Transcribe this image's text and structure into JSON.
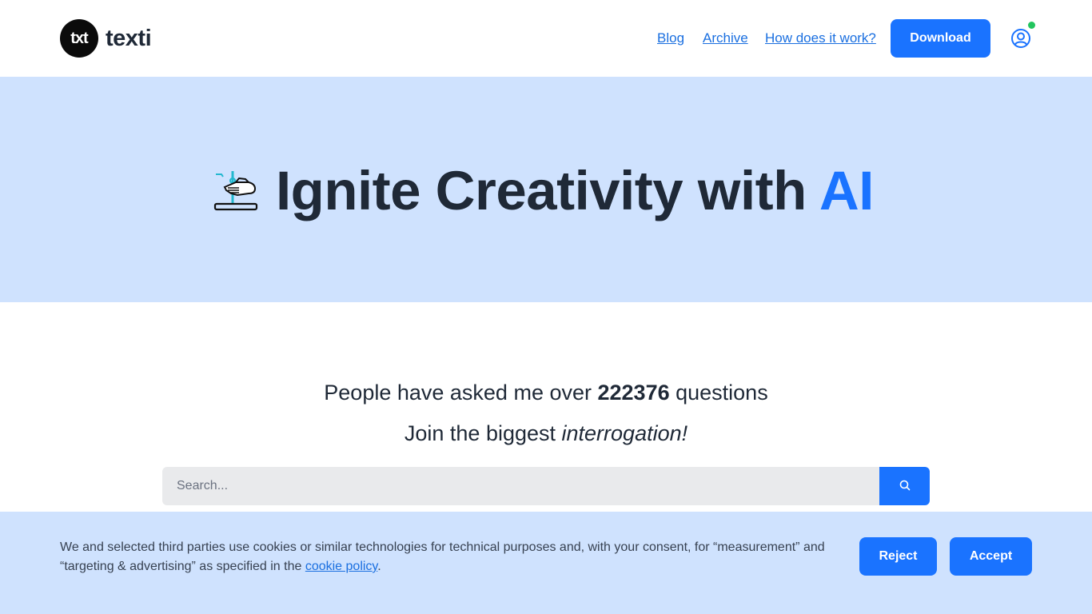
{
  "header": {
    "logo_mark": "txt",
    "logo_text": "texti",
    "nav": {
      "blog": "Blog",
      "archive": "Archive",
      "how": "How does it work?"
    },
    "download_label": "Download",
    "user_icon": "user-circle-icon",
    "status_color": "#22c55e"
  },
  "hero": {
    "icon": "hand-on-lever-icon",
    "title_main": "Ignite Creativity with ",
    "title_accent": "AI"
  },
  "main": {
    "stats_prefix": "People have asked me over ",
    "stats_count": "222376",
    "stats_suffix": " questions",
    "join_prefix": "Join the biggest ",
    "join_emphasis": "interrogation!",
    "search_placeholder": "Search...",
    "search_icon": "search-icon"
  },
  "cookie": {
    "text": "We and selected third parties use cookies or similar technologies for technical purposes and, with your consent, for “measurement” and “targeting & advertising” as specified in the ",
    "link_text": "cookie policy",
    "text_end": ".",
    "reject_label": "Reject",
    "accept_label": "Accept"
  },
  "colors": {
    "accent": "#1a73ff",
    "hero_bg": "#cfe2fe",
    "text_dark": "#1f2937"
  }
}
